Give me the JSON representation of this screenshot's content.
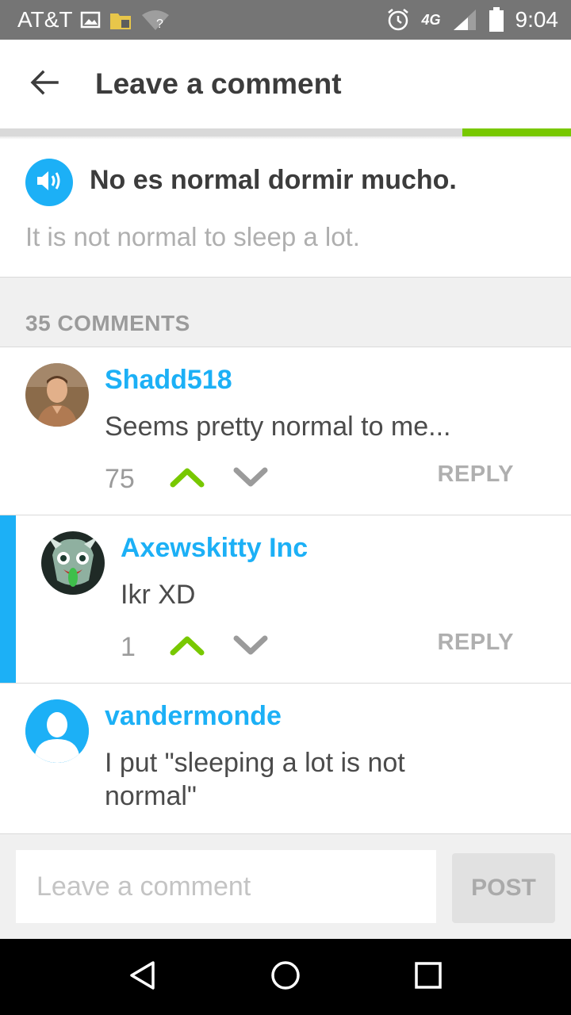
{
  "status_bar": {
    "carrier": "AT&T",
    "network": "4G",
    "time": "9:04",
    "icons": [
      "image-icon",
      "sd-card-icon",
      "wifi-unknown-icon",
      "alarm-icon",
      "signal-icon",
      "battery-icon"
    ]
  },
  "header": {
    "title": "Leave a comment",
    "back_icon": "arrow-left-icon"
  },
  "progress": {
    "fraction": 0.19,
    "color": "#78c800"
  },
  "sentence": {
    "text": "No es normal dormir mucho.",
    "translation": "It is not normal to sleep a lot.",
    "speaker_icon": "speaker-icon"
  },
  "comments_header": {
    "label": "35 COMMENTS"
  },
  "comments": [
    {
      "username": "Shadd518",
      "body": "Seems pretty normal to me...",
      "votes": "75",
      "reply_label": "REPLY",
      "nested": false
    },
    {
      "username": "Axewskitty Inc",
      "body": "Ikr XD",
      "votes": "1",
      "reply_label": "REPLY",
      "nested": true
    },
    {
      "username": "vandermonde",
      "body": "I put \"sleeping a lot is not normal\"",
      "nested": false
    }
  ],
  "composer": {
    "placeholder": "Leave a comment",
    "post_label": "POST"
  },
  "colors": {
    "accent_blue": "#1cb0f6",
    "upvote_green": "#78c800",
    "text_dark": "#3c3c3c",
    "muted": "#afafaf"
  }
}
